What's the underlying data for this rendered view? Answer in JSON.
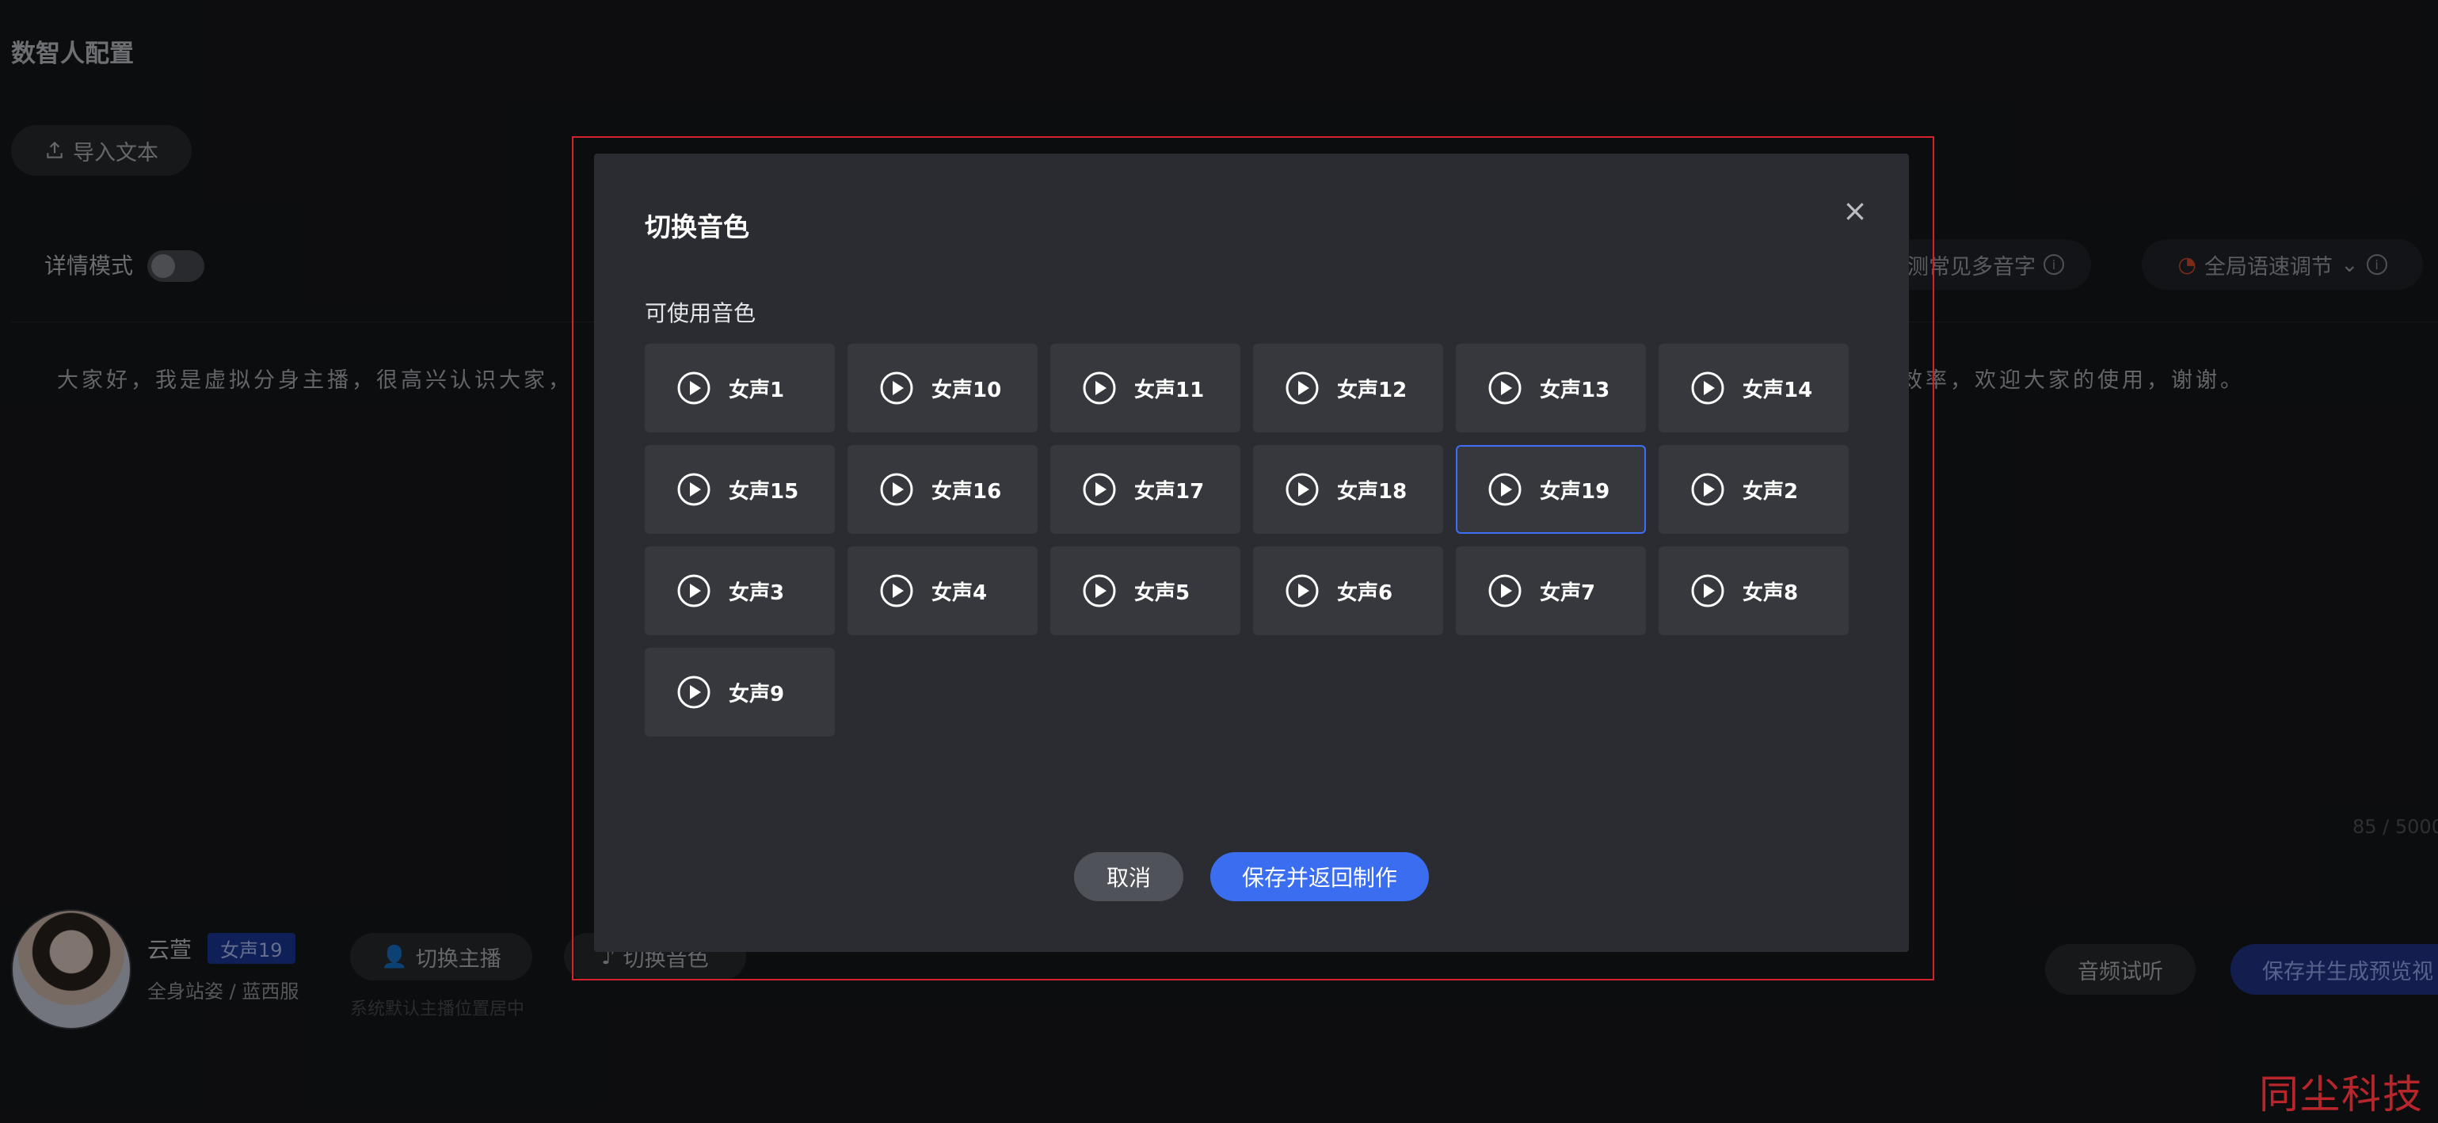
{
  "page": {
    "title": "数智人配置",
    "import_button": "导入文本",
    "detail_mode_label": "详情模式",
    "polyphone_button": "测常见多音字",
    "speed_button": "全局语速调节",
    "script_text_left": "大家好，我是虚拟分身主播，很高兴认识大家，",
    "script_text_right": "效率，欢迎大家的使用，谢谢。",
    "char_count": "85 / 5000",
    "anchor": {
      "name": "云萱",
      "voice_tag": "女声19",
      "description": "全身站姿 / 蓝西服",
      "switch_anchor_button": "切换主播",
      "switch_voice_button": "切换音色",
      "hint": "系统默认主播位置居中"
    },
    "audio_preview_button": "音频试听",
    "save_preview_button": "保存并生成预览视",
    "watermark": "同尘科技"
  },
  "modal": {
    "title": "切换音色",
    "close_icon": "close-icon",
    "section_label": "可使用音色",
    "voices": [
      {
        "label": "女声1",
        "selected": false
      },
      {
        "label": "女声10",
        "selected": false
      },
      {
        "label": "女声11",
        "selected": false
      },
      {
        "label": "女声12",
        "selected": false
      },
      {
        "label": "女声13",
        "selected": false
      },
      {
        "label": "女声14",
        "selected": false
      },
      {
        "label": "女声15",
        "selected": false
      },
      {
        "label": "女声16",
        "selected": false
      },
      {
        "label": "女声17",
        "selected": false
      },
      {
        "label": "女声18",
        "selected": false
      },
      {
        "label": "女声19",
        "selected": true
      },
      {
        "label": "女声2",
        "selected": false
      },
      {
        "label": "女声3",
        "selected": false
      },
      {
        "label": "女声4",
        "selected": false
      },
      {
        "label": "女声5",
        "selected": false
      },
      {
        "label": "女声6",
        "selected": false
      },
      {
        "label": "女声7",
        "selected": false
      },
      {
        "label": "女声8",
        "selected": false
      },
      {
        "label": "女声9",
        "selected": false
      }
    ],
    "cancel_button": "取消",
    "save_button": "保存并返回制作"
  },
  "colors": {
    "accent": "#3a6df0",
    "selected_border": "#3d6ef5",
    "modal_bg": "#2a2c31",
    "card_bg": "#36383e",
    "page_bg": "#17181c",
    "watermark": "#b8262c",
    "annotation_frame": "#d3232b"
  }
}
